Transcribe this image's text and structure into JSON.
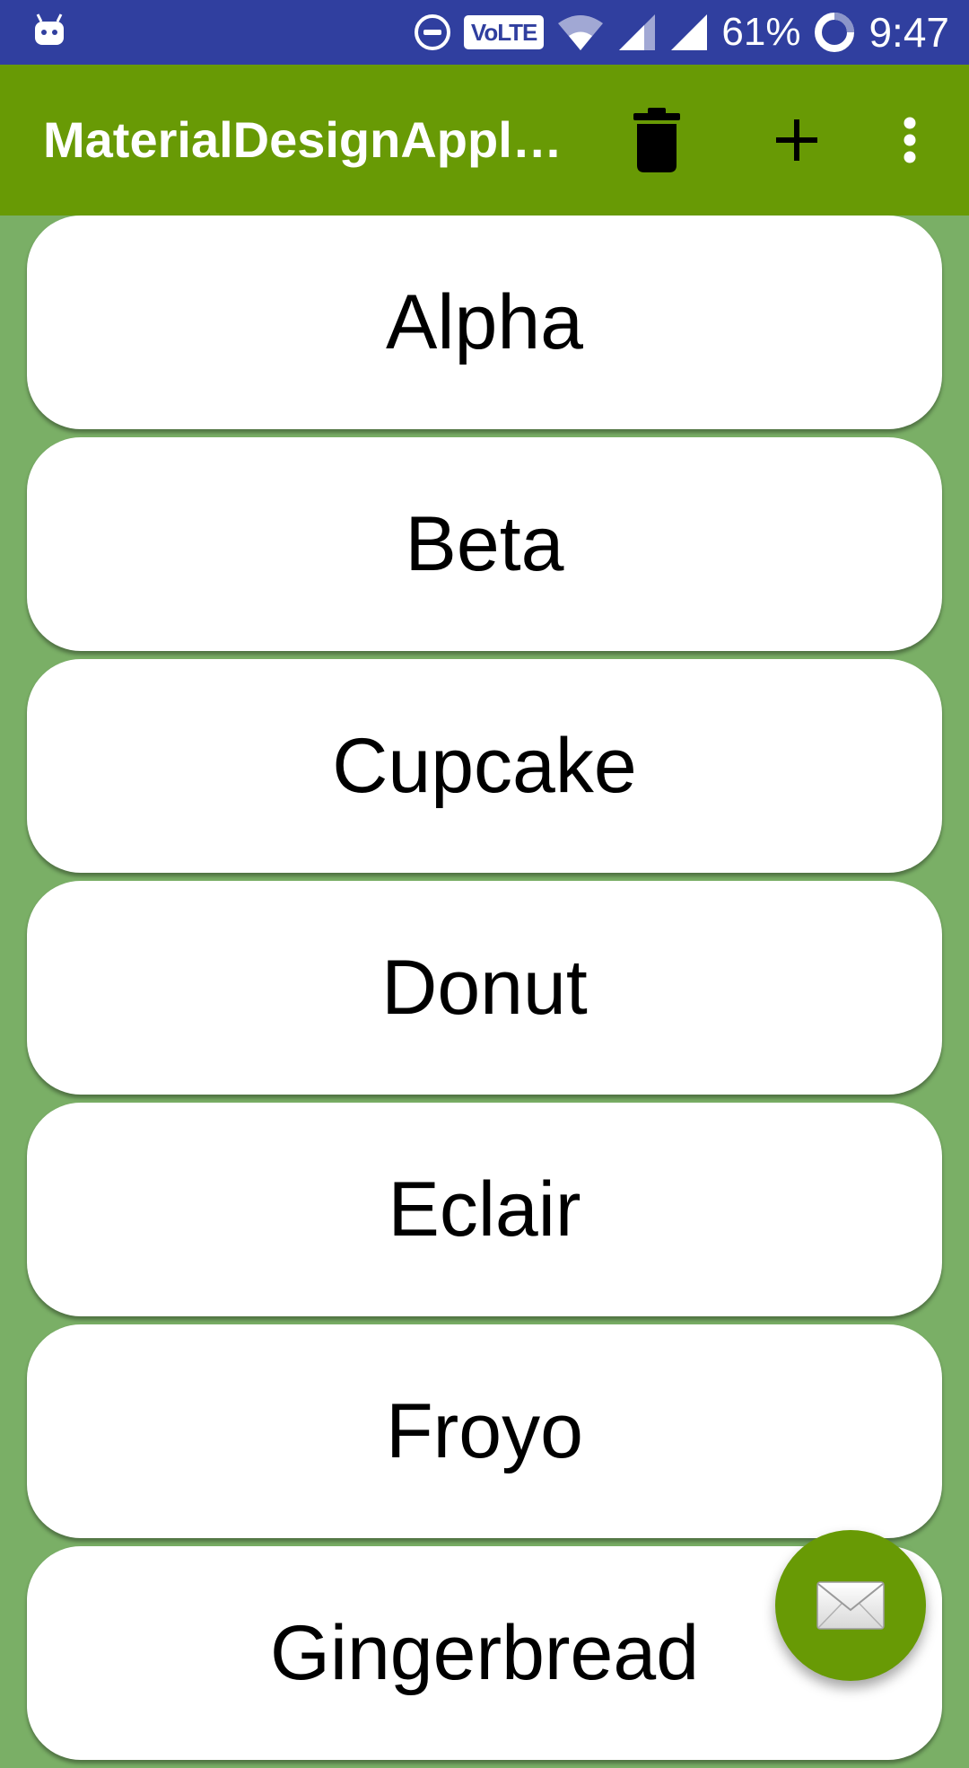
{
  "status_bar": {
    "battery": "61%",
    "time": "9:47",
    "volte": "VoLTE",
    "icons": [
      "android-notification-icon",
      "do-not-disturb-icon",
      "volte-icon",
      "wifi-icon",
      "cell-signal-icon",
      "cell-signal-icon",
      "battery-saver-icon"
    ]
  },
  "app_bar": {
    "title": "MaterialDesignAppl…",
    "actions": [
      "delete-icon",
      "add-icon",
      "more-vert-icon"
    ]
  },
  "list": {
    "items": [
      {
        "label": "Alpha"
      },
      {
        "label": "Beta"
      },
      {
        "label": "Cupcake"
      },
      {
        "label": "Donut"
      },
      {
        "label": "Eclair"
      },
      {
        "label": "Froyo"
      },
      {
        "label": "Gingerbread"
      }
    ]
  },
  "fab": {
    "icon": "email-icon"
  },
  "colors": {
    "status_bar": "#303f9f",
    "app_bar": "#689a05",
    "background": "#7aaf66",
    "card": "#ffffff"
  }
}
